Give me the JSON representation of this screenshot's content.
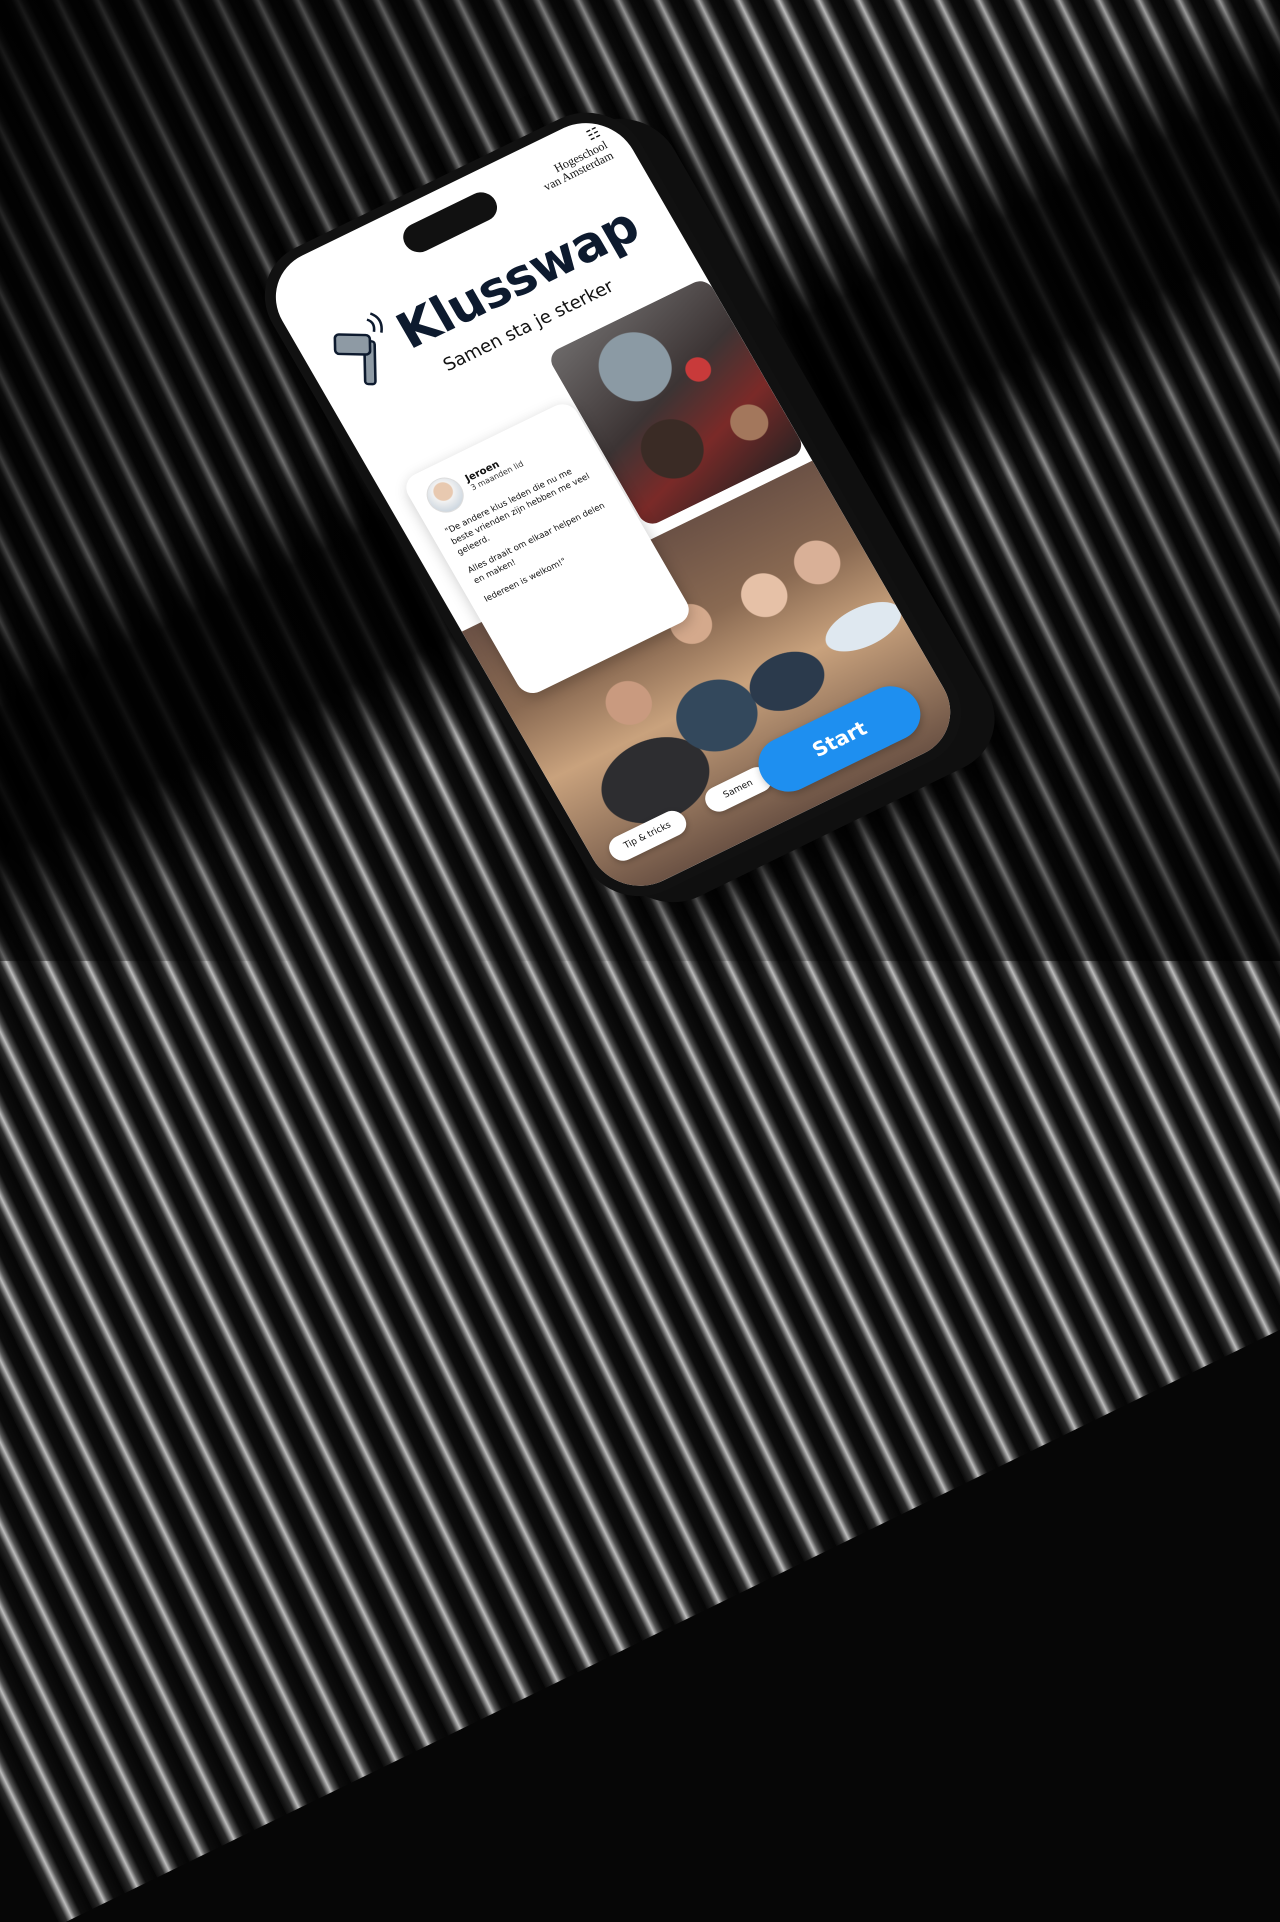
{
  "brand": {
    "school_line1": "Hogeschool",
    "school_line2": "van Amsterdam",
    "app_title": "Klusswap",
    "tagline": "Samen sta je sterker"
  },
  "testimonial": {
    "author": "Jeroen",
    "member_since": "3 maanden lid",
    "paragraphs": [
      "\"De andere klus leden die nu me beste vrienden zijn hebben me veel geleerd.",
      "Alles draait om elkaar helpen delen en maken!",
      "Iedereen is welkom!\""
    ]
  },
  "chips": {
    "tips": "Tip & tricks",
    "samen": "Samen"
  },
  "actions": {
    "start": "Start"
  },
  "colors": {
    "accent": "#1e8ff0",
    "title": "#0d1a2e",
    "background": "#060606"
  },
  "icons": [
    "hva-logo-icon",
    "hammer-icon"
  ]
}
